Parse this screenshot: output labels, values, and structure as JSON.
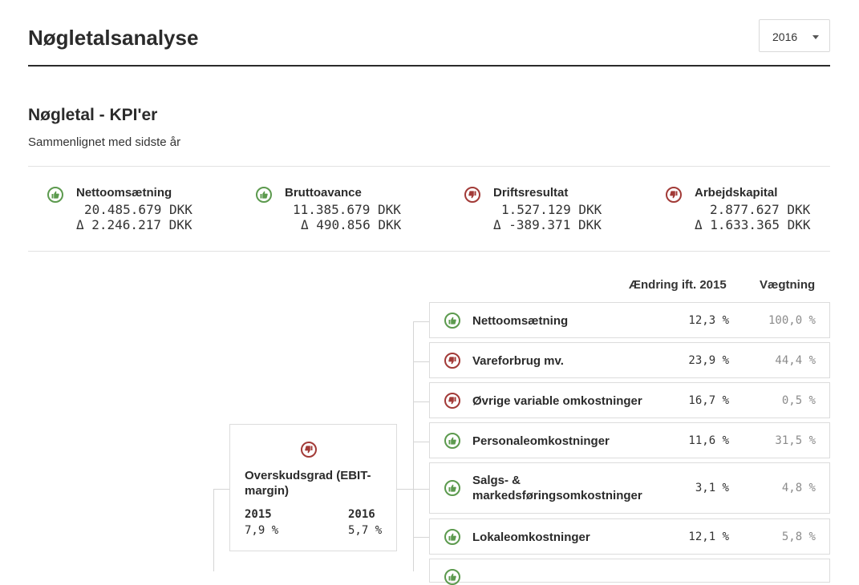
{
  "page": {
    "title": "Nøgletalsanalyse"
  },
  "year_select": {
    "value": "2016"
  },
  "section": {
    "title": "Nøgletal - KPI'er",
    "subtitle": "Sammenlignet med sidste år"
  },
  "kpis": [
    {
      "name": "Nettoomsætning",
      "value": "20.485.679 DKK",
      "delta": "Δ 2.246.217 DKK",
      "status": "good"
    },
    {
      "name": "Bruttoavance",
      "value": "11.385.679 DKK",
      "delta": "Δ 490.856 DKK",
      "status": "good"
    },
    {
      "name": "Driftsresultat",
      "value": "1.527.129 DKK",
      "delta": "Δ -389.371 DKK",
      "status": "bad"
    },
    {
      "name": "Arbejdskapital",
      "value": "2.877.627 DKK",
      "delta": "Δ 1.633.365 DKK",
      "status": "bad"
    }
  ],
  "table": {
    "col_change": "Ændring ift. 2015",
    "col_weight": "Vægtning",
    "rows": [
      {
        "name": "Nettoomsætning",
        "change": "12,3 %",
        "weight": "100,0 %",
        "status": "good"
      },
      {
        "name": "Vareforbrug mv.",
        "change": "23,9 %",
        "weight": "44,4 %",
        "status": "bad"
      },
      {
        "name": "Øvrige variable omkostninger",
        "change": "16,7 %",
        "weight": "0,5 %",
        "status": "bad"
      },
      {
        "name": "Personaleomkostninger",
        "change": "11,6 %",
        "weight": "31,5 %",
        "status": "good"
      },
      {
        "name": "Salgs- & markedsføringsomkostninger",
        "change": "3,1 %",
        "weight": "4,8 %",
        "status": "good"
      },
      {
        "name": "Lokaleomkostninger",
        "change": "12,1 %",
        "weight": "5,8 %",
        "status": "good"
      }
    ]
  },
  "ebit_card": {
    "name": "Overskudsgrad (EBIT-margin)",
    "year_prev": "2015",
    "value_prev": "7,9 %",
    "year_curr": "2016",
    "value_curr": "5,7 %",
    "status": "bad"
  },
  "colors": {
    "good": "#5c9a4e",
    "bad": "#a23a37"
  },
  "icons": {
    "good": "thumbs-up-icon",
    "bad": "thumbs-down-icon"
  }
}
